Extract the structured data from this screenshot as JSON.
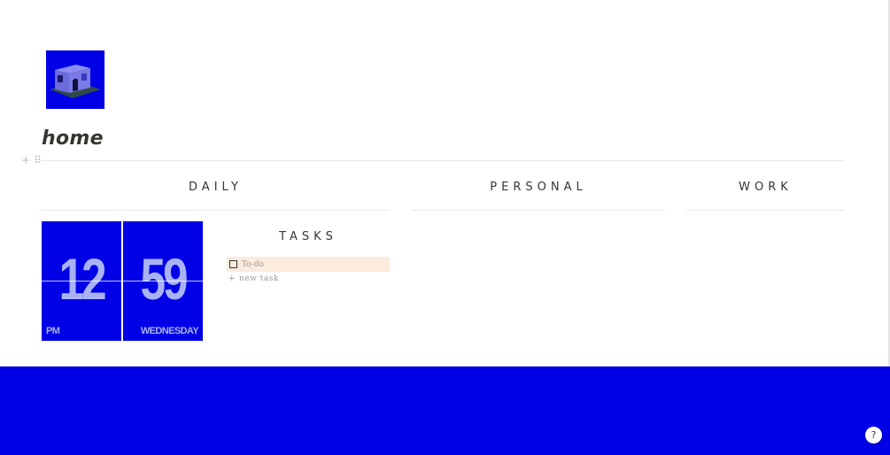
{
  "page": {
    "title": "home",
    "icon": "blue-house-icon"
  },
  "editor": {
    "add_block_icon": "+",
    "drag_handle_icon": "⠿"
  },
  "columns": [
    {
      "heading": "DAILY"
    },
    {
      "heading": "PERSONAL"
    },
    {
      "heading": "WORK"
    }
  ],
  "clock": {
    "hour": "12",
    "minute": "59",
    "meridiem": "PM",
    "weekday": "WEDNESDAY"
  },
  "tasks": {
    "heading": "TASKS",
    "items": [
      {
        "label": "To-do",
        "checked": false
      }
    ],
    "new_task_label": "new task",
    "new_task_icon": "+"
  },
  "help": {
    "label": "?"
  },
  "colors": {
    "accent_blue": "#0000e6",
    "task_highlight": "#faebdd",
    "text": "#37352f",
    "muted_text": "#9b9a97",
    "clock_digits": "#a9b2f4"
  }
}
